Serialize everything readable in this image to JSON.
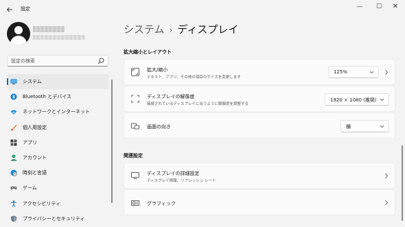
{
  "window": {
    "app_title": "設定",
    "back_icon": "arrow-left-icon",
    "controls": {
      "minimize": "—",
      "maximize": "☐",
      "close": "✕"
    }
  },
  "sidebar": {
    "search": {
      "placeholder": "設定の検索"
    },
    "items": [
      {
        "label": "システム",
        "icon": "monitor-icon",
        "active": true
      },
      {
        "label": "Bluetooth とデバイス",
        "icon": "bluetooth-icon"
      },
      {
        "label": "ネットワークとインターネット",
        "icon": "wifi-icon"
      },
      {
        "label": "個人用設定",
        "icon": "paintbrush-icon"
      },
      {
        "label": "アプリ",
        "icon": "apps-icon"
      },
      {
        "label": "アカウント",
        "icon": "person-icon"
      },
      {
        "label": "時刻と言語",
        "icon": "globe-clock-icon"
      },
      {
        "label": "ゲーム",
        "icon": "gamepad-icon"
      },
      {
        "label": "アクセシビリティ",
        "icon": "accessibility-icon"
      },
      {
        "label": "プライバシーとセキュリティ",
        "icon": "shield-icon"
      }
    ]
  },
  "main": {
    "breadcrumb": {
      "parent": "システム",
      "separator": "›",
      "current": "ディスプレイ"
    },
    "scale_layout": {
      "heading": "拡大縮小とレイアウト",
      "scale": {
        "title": "拡大/縮小",
        "subtitle": "テキスト、アプリ、その他の項目のサイズを変更します",
        "value": "125%"
      },
      "resolution": {
        "title": "ディスプレイの解像度",
        "subtitle": "接続されているディスプレイに合うように解像度を調整する",
        "value": "1920 × 1080 (推奨)"
      },
      "orientation": {
        "title": "画面の向き",
        "value": "横"
      }
    },
    "related": {
      "heading": "関連設定",
      "advanced": {
        "title": "ディスプレイの詳細設定",
        "subtitle": "ディスプレイ情報、リフレッシュ レート"
      },
      "graphics": {
        "title": "グラフィック"
      }
    }
  },
  "colors": {
    "accent": "#0067c0",
    "background": "#f3f3f3",
    "card": "#fbfbfb"
  }
}
